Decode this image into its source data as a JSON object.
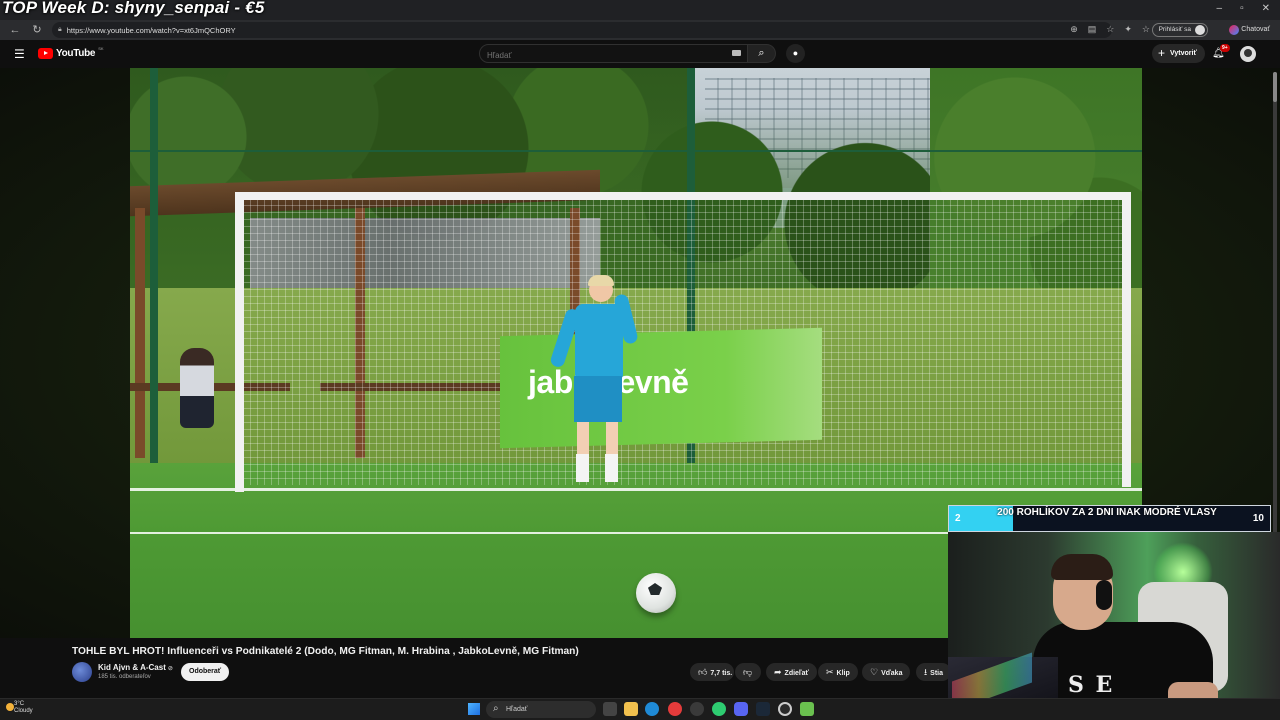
{
  "stream": {
    "overlay_title": "TOP Week D: shyny_senpai - €5"
  },
  "browser": {
    "url": "https://www.youtube.com/watch?v=xt6JmQChORY",
    "signin_label": "Prihlásiť sa",
    "chat_label": "Chatovať"
  },
  "youtube": {
    "logo_text": "YouTube",
    "country_code": "SK",
    "search_placeholder": "Hľadať",
    "create_label": "Vytvoriť",
    "notif_badge": "9+"
  },
  "video": {
    "title": "TOHLE BYL HROT! Influenceři vs Podnikatelé 2 (Dodo, MG Fitman, M. Hrabina , JabkoLevně, MG Fitman)",
    "banner_text": "jabkolevně",
    "channel": "Kid Ajvn & A-Cast",
    "subscribers": "185 tis. odberateľov",
    "subscribe_label": "Odoberať",
    "likes": "7,7 tis.",
    "share_label": "Zdieľať",
    "clip_label": "Klip",
    "thanks_label": "Vďaka",
    "download_label": "Stia"
  },
  "goal": {
    "current": "2",
    "max": "10",
    "progress": 0.2,
    "label": "200 ROHLÍKOV ZA 2 DNI INAK MODRÉ VLASY"
  },
  "taskbar": {
    "temperature": "3°C",
    "condition": "Cloudy",
    "search_label": "Hľadať"
  },
  "colors": {
    "goal_fill": "#33d1f2",
    "youtube_red": "#ff0000"
  }
}
